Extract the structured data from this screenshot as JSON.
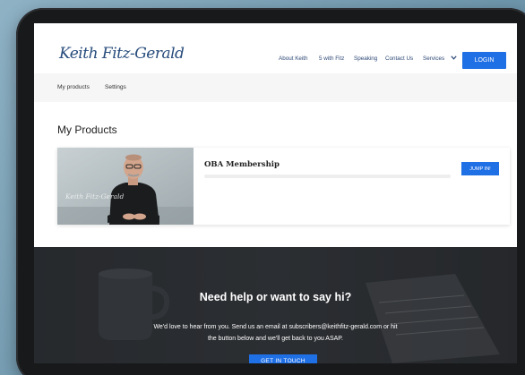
{
  "header": {
    "logo_text": "Keith Fitz-Gerald",
    "nav": [
      "About Keith",
      "5 with Fitz",
      "Speaking",
      "Contact Us",
      "Services"
    ],
    "login_label": "LOGIN"
  },
  "subnav": {
    "items": [
      "My products",
      "Settings"
    ]
  },
  "products": {
    "title": "My Products",
    "items": [
      {
        "name": "OBA Membership",
        "thumb_signature": "Keith Fitz-Gerald",
        "progress": 0,
        "button_label": "JUMP IN!"
      }
    ]
  },
  "footer": {
    "title": "Need help or want to say hi?",
    "text_line1": "We'd love to hear from you. Send us an email at subscribers@keithfitz-gerald.com or hit",
    "text_line2": "the button below and we'll get back to you ASAP.",
    "button_label": "GET IN TOUCH"
  },
  "colors": {
    "accent": "#1f6fe5",
    "logo": "#274c7c",
    "footer_bg": "#2a2d31"
  },
  "icons": {
    "services_dropdown": "chevron-down-icon"
  }
}
